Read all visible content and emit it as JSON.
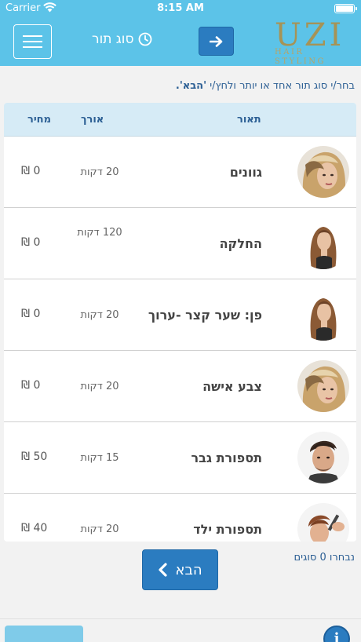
{
  "status_bar": {
    "carrier": "Carrier",
    "time": "8:15 AM"
  },
  "nav": {
    "title": "סוג תור",
    "logo_main": "UZI",
    "logo_sub": "HAIR STYLING",
    "accent_color": "#5cc3e8",
    "button_color": "#2b7cc0"
  },
  "instruction": {
    "text": "בחר/י סוג תור אחד או יותר ולחץ/י ",
    "highlight": "'הבא'."
  },
  "table": {
    "headers": {
      "description": "תאור",
      "length": "אורך",
      "price": "מחיר"
    },
    "rows": [
      {
        "name": "גוונים",
        "length": "20 דקות",
        "price": "0 ₪",
        "avatar": "woman-highlights-icon"
      },
      {
        "name": "החלקה",
        "length": "120 דקות",
        "price": "0 ₪",
        "avatar": "woman-long-hair-icon"
      },
      {
        "name": "פן: שער קצר -ערוך",
        "length": "20 דקות",
        "price": "0 ₪",
        "avatar": "woman-long-hair-icon"
      },
      {
        "name": "צבע אישה",
        "length": "20 דקות",
        "price": "0 ₪",
        "avatar": "woman-highlights-icon"
      },
      {
        "name": "תספורת גבר",
        "length": "15 דקות",
        "price": "50 ₪",
        "avatar": "man-portrait-icon"
      },
      {
        "name": "תספורת ילד",
        "length": "20 דקות",
        "price": "40 ₪",
        "avatar": "child-haircut-icon"
      }
    ]
  },
  "footer": {
    "selected_count": "נבחרו 0 סוגים",
    "next_label": "הבא"
  }
}
